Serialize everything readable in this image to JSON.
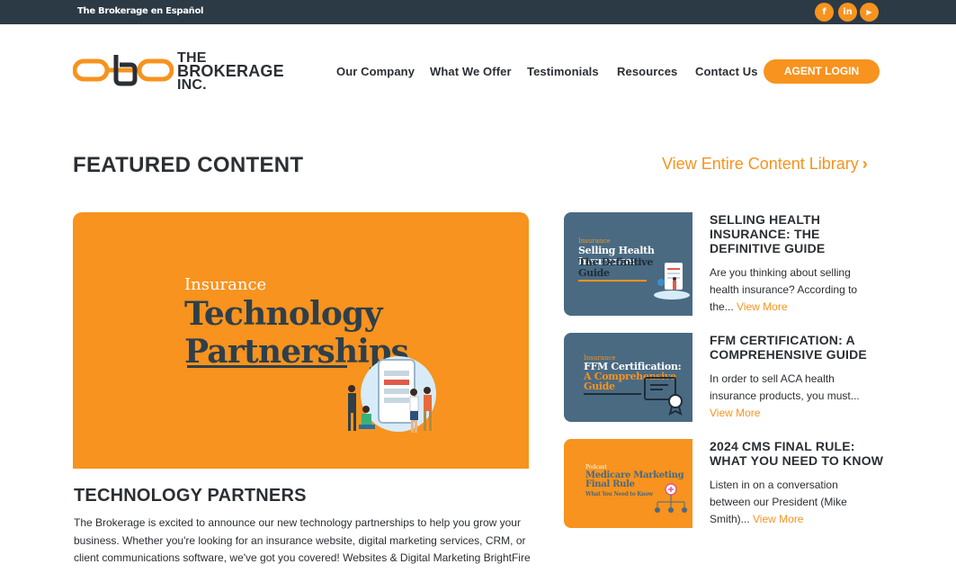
{
  "topbar": {
    "spanish_link": "The Brokerage en Español",
    "social": [
      {
        "icon": "facebook-icon",
        "glyph": "f"
      },
      {
        "icon": "linkedin-icon",
        "glyph": "in"
      },
      {
        "icon": "youtube-icon",
        "glyph": "▶"
      }
    ]
  },
  "logo": {
    "line1": "THE",
    "line2": "BROKERAGE",
    "line3": "INC."
  },
  "nav": {
    "items": [
      "Our Company",
      "What We Offer",
      "Testimonials",
      "Resources",
      "Contact Us"
    ],
    "login": "AGENT LOGIN"
  },
  "featured": {
    "title": "FEATURED CONTENT",
    "library_link": "View Entire Content Library",
    "library_chevron": "›"
  },
  "main_article": {
    "image_small": "Insurance",
    "image_big_1": "Technology",
    "image_big_2": "Partnerships",
    "title": "TECHNOLOGY PARTNERS",
    "description": "The Brokerage is excited to announce our new technology partnerships to help you grow your business. Whether you're looking for an insurance website, digital marketing services, CRM, or client communications software, we've got you covered! Websites & Digital Marketing BrightFire"
  },
  "side_articles": [
    {
      "thumb_small": "Insurance",
      "thumb_big": "Selling Health Insurance:",
      "thumb_big_2": "The Definitive",
      "thumb_big_3": "Guide",
      "title": "SELLING HEALTH INSURANCE: THE DEFINITIVE GUIDE",
      "excerpt": "Are you thinking about selling health insurance? According to the...",
      "more": "View More"
    },
    {
      "thumb_small": "Insurance",
      "thumb_big": "FFM Certification:",
      "thumb_big_2": "A Comprehensive",
      "thumb_big_3": "Guide",
      "title": "FFM CERTIFICATION: A COMPREHENSIVE GUIDE",
      "excerpt": "In order to sell ACA health insurance products, you must...",
      "more": "View More"
    },
    {
      "thumb_small": "Podcast",
      "thumb_big": "Medicare Marketing",
      "thumb_big_2": "Final Rule",
      "thumb_big_3": "What You Need to Know",
      "title": "2024 CMS FINAL RULE: WHAT YOU NEED TO KNOW",
      "excerpt": "Listen in on a conversation between our President (Mike Smith)...",
      "more": "View More"
    }
  ],
  "colors": {
    "accent": "#f7931e",
    "dark": "#2c3a45",
    "slate": "#4a6a82"
  }
}
